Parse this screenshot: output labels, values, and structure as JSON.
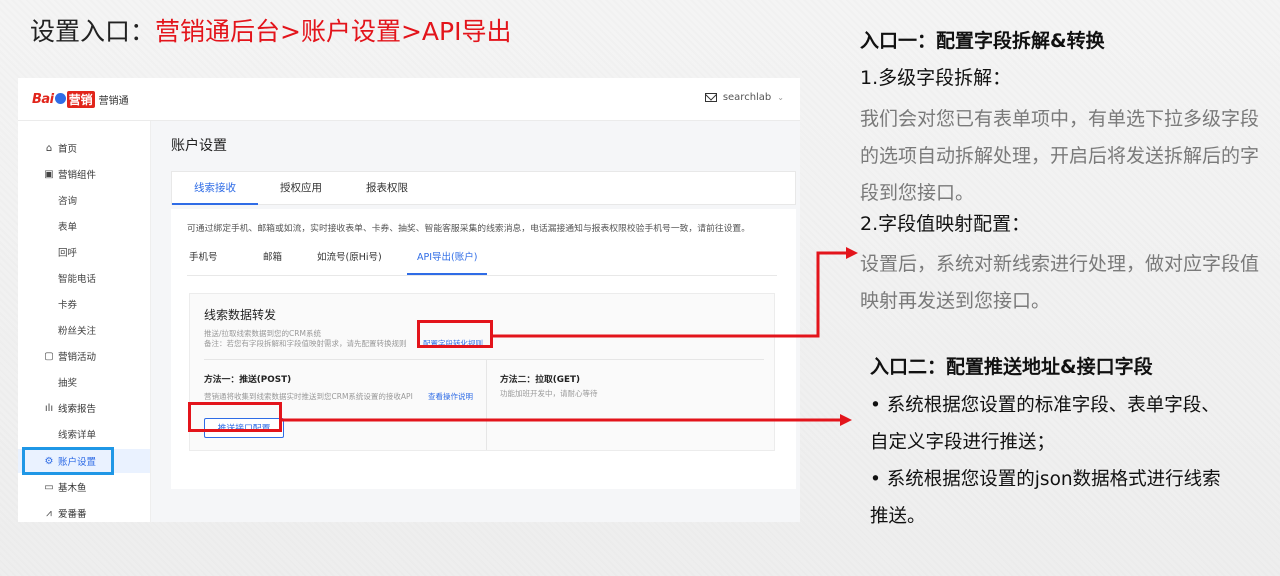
{
  "slide": {
    "title_prefix": "设置入口：",
    "title_path": "营销通后台>账户设置>API导出"
  },
  "app": {
    "brand_bai": "Bai",
    "brand_yx": "营销",
    "brand_name": "营销通",
    "user_name": "searchlab"
  },
  "sidebar": {
    "items": [
      {
        "label": "首页",
        "icon": "home-icon"
      },
      {
        "label": "营销组件",
        "icon": "component-icon"
      },
      {
        "label": "咨询"
      },
      {
        "label": "表单"
      },
      {
        "label": "回呼"
      },
      {
        "label": "智能电话"
      },
      {
        "label": "卡券"
      },
      {
        "label": "粉丝关注"
      },
      {
        "label": "营销活动",
        "icon": "activity-icon"
      },
      {
        "label": "抽奖"
      },
      {
        "label": "线索报告",
        "icon": "report-icon"
      },
      {
        "label": "线索详单"
      },
      {
        "label": "账户设置",
        "icon": "settings-icon",
        "active": true
      },
      {
        "label": "基木鱼",
        "icon": "jimuyu-icon"
      },
      {
        "label": "爱番番",
        "icon": "aifanfan-icon"
      }
    ]
  },
  "main": {
    "page_title": "账户设置",
    "tabs": [
      "线索接收",
      "授权应用",
      "报表权限"
    ],
    "active_tab": "线索接收",
    "note": "可通过绑定手机、邮箱或如流，实时接收表单、卡券、抽奖、智能客服采集的线索消息，电话漏接通知与报表权限校验手机号一致，请前往设置。",
    "subtabs": [
      "手机号",
      "邮箱",
      "如流号(原Hi号)",
      "API导出(账户)"
    ],
    "active_subtab": "API导出(账户)",
    "forward": {
      "title": "线索数据转发",
      "desc1": "推送/拉取线索数据到您的CRM系统",
      "desc2": "备注：若您有字段拆解和字段值映射需求，请先配置转换规则",
      "config_link": "配置字段转化规则",
      "method1_title": "方法一：推送(POST)",
      "method1_desc": "营销通将收集到线索数据实时推送到您CRM系统设置的接收API",
      "method1_link": "查看操作说明",
      "method2_title": "方法二：拉取(GET)",
      "method2_desc": "功能加班开发中，请耐心等待",
      "push_button": "推送接口配置"
    }
  },
  "right_panel": {
    "entry1_title": "入口一：配置字段拆解&转换",
    "entry1_s1": "1.多级字段拆解：",
    "entry1_p1": "我们会对您已有表单项中，有单选下拉多级字段的选项自动拆解处理，开启后将发送拆解后的字段到您接口。",
    "entry1_s2": "2.字段值映射配置：",
    "entry1_p2": "设置后，系统对新线索进行处理，做对应字段值映射再发送到您接口。",
    "entry2_title": "入口二：配置推送地址&接口字段",
    "bullet1_a": "• 系统根据您设置的标准字段、表单字段、",
    "bullet1_b": "自定义字段进行推送；",
    "bullet2_a": "• 系统根据您设置的json数据格式进行线索",
    "bullet2_b": "推送。"
  },
  "colors": {
    "accent_red": "#e3141b",
    "highlight_blue": "#1f97e6",
    "ui_blue": "#2f6ce6"
  }
}
